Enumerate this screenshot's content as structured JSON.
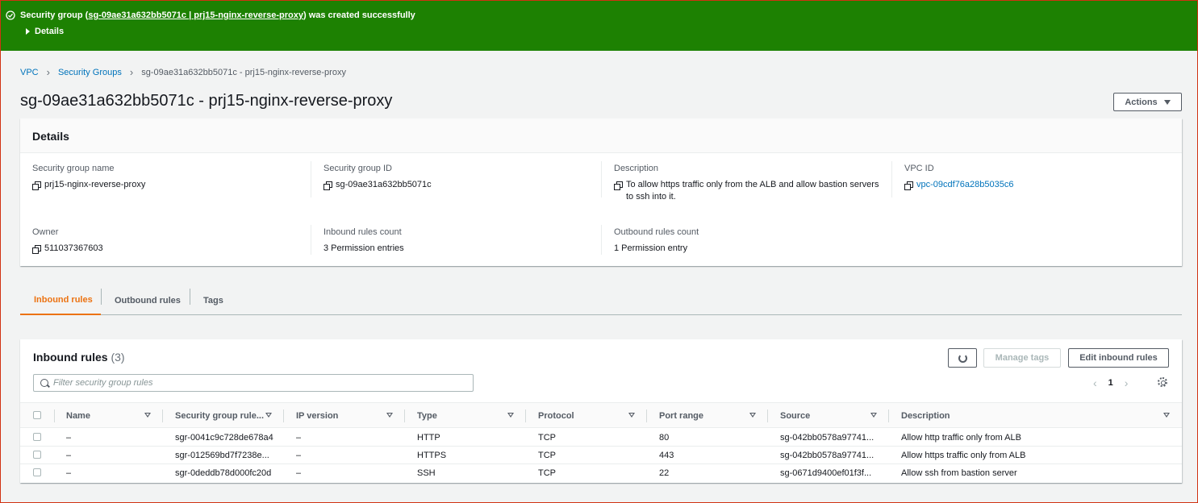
{
  "flash": {
    "prefix": "Security group (",
    "link": "sg-09ae31a632bb5071c | prj15-nginx-reverse-proxy",
    "suffix": ") was created successfully",
    "details": "Details",
    "color": "#1d8102"
  },
  "breadcrumb": {
    "items": [
      "VPC",
      "Security Groups",
      "sg-09ae31a632bb5071c - prj15-nginx-reverse-proxy"
    ]
  },
  "page": {
    "title": "sg-09ae31a632bb5071c - prj15-nginx-reverse-proxy",
    "actions_label": "Actions"
  },
  "details": {
    "header": "Details",
    "fields": [
      {
        "label": "Security group name",
        "value": "prj15-nginx-reverse-proxy"
      },
      {
        "label": "Security group ID",
        "value": "sg-09ae31a632bb5071c"
      },
      {
        "label": "Description",
        "value": "To allow https traffic only from the ALB and allow bastion servers to ssh into it."
      },
      {
        "label": "VPC ID",
        "value": "vpc-09cdf76a28b5035c6"
      },
      {
        "label": "Owner",
        "value": "511037367603"
      },
      {
        "label": "Inbound rules count",
        "value": "3 Permission entries"
      },
      {
        "label": "Outbound rules count",
        "value": "1 Permission entry"
      }
    ]
  },
  "tabs": [
    {
      "label": "Inbound rules",
      "active": true
    },
    {
      "label": "Outbound rules",
      "active": false
    },
    {
      "label": "Tags",
      "active": false
    }
  ],
  "inbound": {
    "title": "Inbound rules",
    "count": "(3)",
    "manage_tags_label": "Manage tags",
    "edit_label": "Edit inbound rules",
    "filter_placeholder": "Filter security group rules",
    "page": "1",
    "columns": [
      "Name",
      "Security group rule...",
      "IP version",
      "Type",
      "Protocol",
      "Port range",
      "Source",
      "Description"
    ],
    "rows": [
      [
        "–",
        "sgr-0041c9c728de678a4",
        "–",
        "HTTP",
        "TCP",
        "80",
        "sg-042bb0578a97741...",
        "Allow http traffic only from ALB"
      ],
      [
        "–",
        "sgr-012569bd7f7238e...",
        "–",
        "HTTPS",
        "TCP",
        "443",
        "sg-042bb0578a97741...",
        "Allow https traffic only from ALB"
      ],
      [
        "–",
        "sgr-0deddb78d000fc20d",
        "–",
        "SSH",
        "TCP",
        "22",
        "sg-0671d9400ef01f3f...",
        "Allow ssh from bastion server"
      ]
    ]
  },
  "colors": {
    "link": "#0073bb",
    "active_tab": "#ec7211",
    "success": "#1d8102"
  }
}
